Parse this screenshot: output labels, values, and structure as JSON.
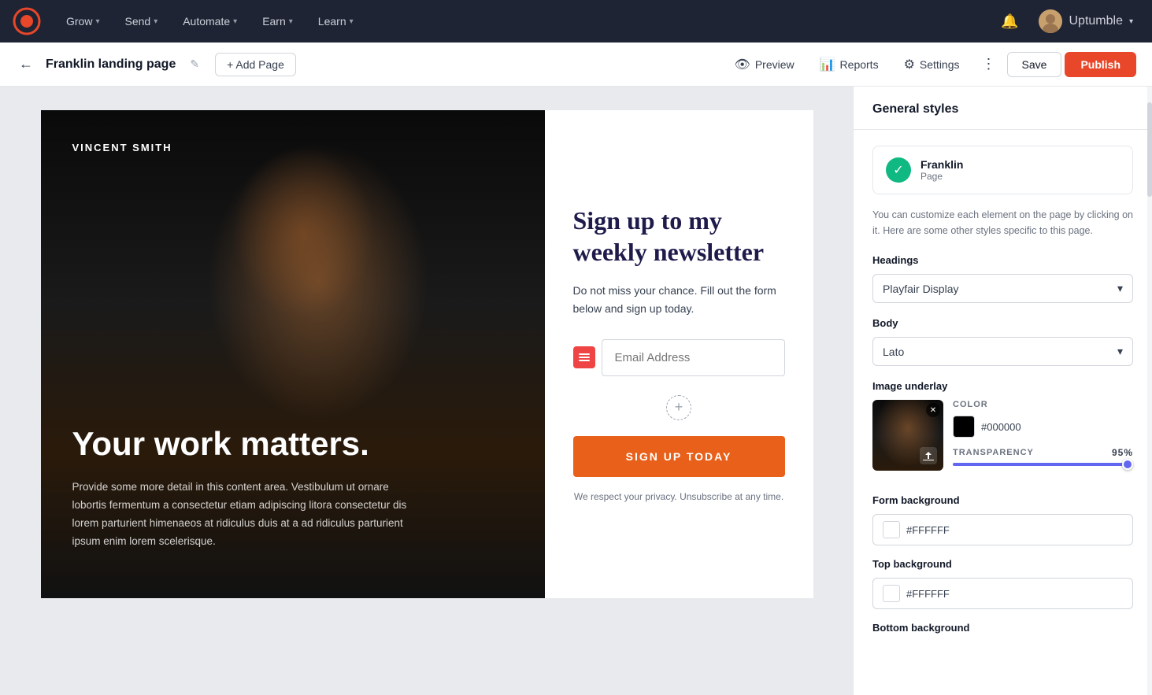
{
  "nav": {
    "logo_alt": "Mailchimp logo",
    "items": [
      {
        "label": "Grow",
        "id": "grow"
      },
      {
        "label": "Send",
        "id": "send"
      },
      {
        "label": "Automate",
        "id": "automate"
      },
      {
        "label": "Earn",
        "id": "earn"
      },
      {
        "label": "Learn",
        "id": "learn"
      }
    ],
    "bell_icon": "🔔",
    "user_name": "Uptumble",
    "chevron": "▾"
  },
  "toolbar": {
    "back_icon": "←",
    "page_title": "Franklin landing page",
    "edit_icon": "✎",
    "add_page_label": "+ Add Page",
    "preview_label": "Preview",
    "reports_label": "Reports",
    "settings_label": "Settings",
    "more_icon": "⋮",
    "save_label": "Save",
    "publish_label": "Publish"
  },
  "canvas": {
    "author_name": "VINCENT SMITH",
    "hero_headline": "Your work matters.",
    "hero_body": "Provide some more detail in this content area. Vestibulum ut ornare lobortis fermentum a consectetur etiam adipiscing litora consectetur dis lorem parturient himenaeos at ridiculus duis at a ad ridiculus parturient ipsum enim lorem scelerisque.",
    "form": {
      "headline": "Sign up to my weekly newsletter",
      "subtext": "Do not miss your chance. Fill out the form below and sign up today.",
      "email_placeholder": "Email Address",
      "submit_label": "SIGN UP TODAY",
      "privacy_text": "We respect your privacy. Unsubscribe at any time."
    }
  },
  "sidebar": {
    "title": "General styles",
    "franklin_name": "Franklin",
    "franklin_sub": "Page",
    "description": "You can customize each element on the page by clicking on it. Here are some other styles specific to this page.",
    "headings_label": "Headings",
    "headings_font": "Playfair Display",
    "body_label": "Body",
    "body_font": "Lato",
    "image_underlay_label": "Image underlay",
    "color_label": "COLOR",
    "color_hex": "#000000",
    "transparency_label": "TRANSPARENCY",
    "transparency_value": "95%",
    "form_bg_label": "Form background",
    "form_bg_hex": "#FFFFFF",
    "top_bg_label": "Top background",
    "top_bg_hex": "#FFFFFF",
    "bottom_bg_label": "Bottom background",
    "chevron_down": "▾",
    "close_icon": "✕",
    "upload_icon": "☁"
  }
}
